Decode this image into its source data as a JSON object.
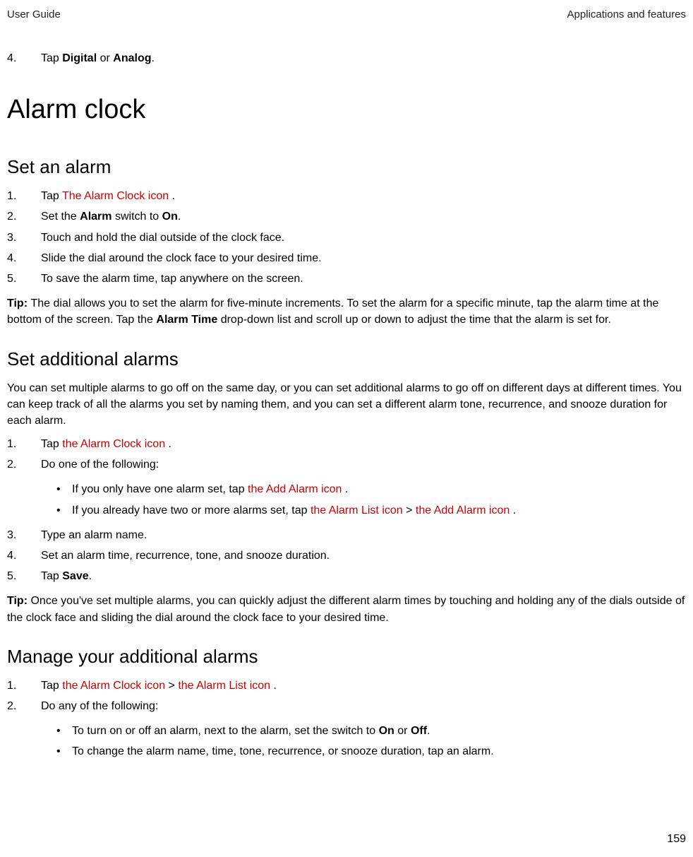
{
  "header": {
    "left": "User Guide",
    "right": "Applications and features"
  },
  "topItem": {
    "num": "4.",
    "text": "Tap ",
    "b1": "Digital",
    "or": " or ",
    "b2": "Analog",
    "end": "."
  },
  "h1": "Alarm clock",
  "sec1": {
    "title": "Set an alarm",
    "items": [
      {
        "num": "1.",
        "pre": "Tap  ",
        "red": "The Alarm Clock icon",
        "post": " ."
      },
      {
        "num": "2.",
        "pre": "Set the ",
        "b1": "Alarm",
        "mid": " switch to ",
        "b2": "On",
        "post": "."
      },
      {
        "num": "3.",
        "text": "Touch and hold the dial outside of the clock face."
      },
      {
        "num": "4.",
        "text": "Slide the dial around the clock face to your desired time."
      },
      {
        "num": "5.",
        "text": "To save the alarm time, tap anywhere on the screen."
      }
    ],
    "tip": {
      "label": "Tip: ",
      "p1": "The dial allows you to set the alarm for five-minute increments. To set the alarm for a specific minute, tap the alarm time at the bottom of the screen. Tap the ",
      "b": "Alarm Time",
      "p2": " drop-down list and scroll up or down to adjust the time that the alarm is set for."
    }
  },
  "sec2": {
    "title": "Set additional alarms",
    "intro": "You can set multiple alarms to go off on the same day, or you can set additional alarms to go off on different days at different times. You can keep track of all the alarms you set by naming them, and you can set a different alarm tone, recurrence, and snooze duration for each alarm.",
    "items": {
      "i1": {
        "num": "1.",
        "pre": "Tap  ",
        "red": "the Alarm Clock icon",
        "post": " ."
      },
      "i2": {
        "num": "2.",
        "text": "Do one of the following:"
      },
      "i3": {
        "num": "3.",
        "text": "Type an alarm name."
      },
      "i4": {
        "num": "4.",
        "text": "Set an alarm time, recurrence, tone, and snooze duration."
      },
      "i5": {
        "num": "5.",
        "pre": "Tap ",
        "b": "Save",
        "post": "."
      }
    },
    "sub": {
      "a": {
        "pre": "If you only have one alarm set, tap  ",
        "red": "the Add Alarm icon",
        "post": " ."
      },
      "b": {
        "pre": "If you already have two or more alarms set, tap  ",
        "red1": "the Alarm List icon",
        "mid": "  >  ",
        "red2": "the Add Alarm icon",
        "post": " ."
      }
    },
    "tip": {
      "label": "Tip: ",
      "text": "Once you've set multiple alarms, you can quickly adjust the different alarm times by touching and holding any of the dials outside of the clock face and sliding the dial around the clock face to your desired time."
    }
  },
  "sec3": {
    "title": "Manage your additional alarms",
    "items": {
      "i1": {
        "num": "1.",
        "pre": "Tap  ",
        "red1": "the Alarm Clock icon",
        "mid": "  >  ",
        "red2": "the Alarm List icon",
        "post": " ."
      },
      "i2": {
        "num": "2.",
        "text": "Do any of the following:"
      }
    },
    "sub": {
      "a": {
        "pre": "To turn on or off an alarm, next to the alarm, set the switch to ",
        "b1": "On",
        "or": " or ",
        "b2": "Off",
        "post": "."
      },
      "b": {
        "text": "To change the alarm name, time, tone, recurrence, or snooze duration, tap an alarm."
      }
    }
  },
  "pageNumber": "159"
}
